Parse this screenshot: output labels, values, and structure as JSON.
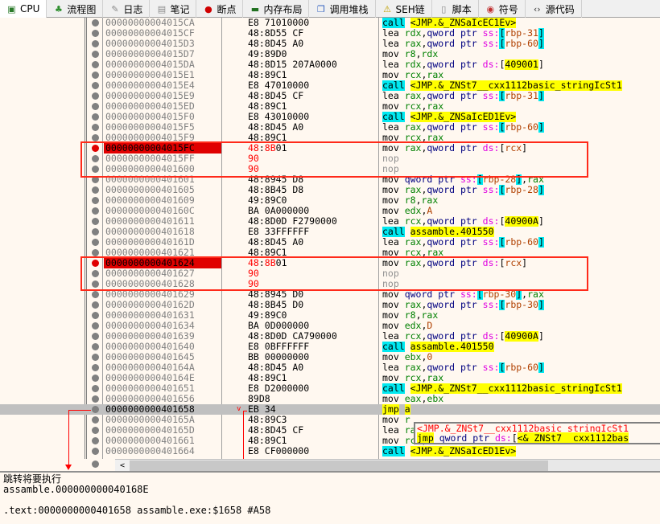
{
  "tabs": [
    {
      "label": "CPU",
      "icon": "cpu-icon",
      "active": true
    },
    {
      "label": "流程图",
      "icon": "tree-icon"
    },
    {
      "label": "日志",
      "icon": "log-icon"
    },
    {
      "label": "笔记",
      "icon": "notes-icon"
    },
    {
      "label": "断点",
      "icon": "breakpoint-icon"
    },
    {
      "label": "内存布局",
      "icon": "memory-icon"
    },
    {
      "label": "调用堆栈",
      "icon": "callstack-icon"
    },
    {
      "label": "SEH链",
      "icon": "seh-icon"
    },
    {
      "label": "脚本",
      "icon": "script-icon"
    },
    {
      "label": "符号",
      "icon": "symbol-icon"
    },
    {
      "label": "源代码",
      "icon": "source-icon"
    }
  ],
  "colors": {
    "breakpoint": "#e00000",
    "call_bg": "#00e8f0",
    "jmp_bg": "#ffff00",
    "highlight_box": "#ff2a1a"
  },
  "rows": [
    {
      "addr": "00000000004015CA",
      "bytes": [
        [
          "E8 71010000",
          ""
        ]
      ],
      "dis": [
        [
          "call",
          "call"
        ],
        [
          " ",
          ""
        ],
        [
          "<JMP.&_ZNSaIcEC1Ev>",
          "a"
        ]
      ]
    },
    {
      "addr": "00000000004015CF",
      "bytes": [
        [
          "48:8D55 CF",
          ""
        ]
      ],
      "dis": [
        [
          "lea ",
          "m"
        ],
        [
          "rdx",
          "r"
        ],
        [
          ",",
          ""
        ],
        [
          "qword ptr ",
          "s"
        ],
        [
          "ss:",
          "g"
        ],
        [
          "[",
          "bk"
        ],
        [
          "rbp-31",
          "n"
        ],
        [
          "]",
          "bk"
        ]
      ]
    },
    {
      "addr": "00000000004015D3",
      "bytes": [
        [
          "48:8D45 A0",
          ""
        ]
      ],
      "dis": [
        [
          "lea ",
          "m"
        ],
        [
          "rax",
          "r"
        ],
        [
          ",",
          ""
        ],
        [
          "qword ptr ",
          "s"
        ],
        [
          "ss:",
          "g"
        ],
        [
          "[",
          "bk"
        ],
        [
          "rbp-60",
          "n"
        ],
        [
          "]",
          "bk"
        ]
      ]
    },
    {
      "addr": "00000000004015D7",
      "bytes": [
        [
          "49:89D0",
          ""
        ]
      ],
      "dis": [
        [
          "mov ",
          "m"
        ],
        [
          "r8",
          "r"
        ],
        [
          ",",
          ""
        ],
        [
          "rdx",
          "r"
        ]
      ]
    },
    {
      "addr": "00000000004015DA",
      "bytes": [
        [
          "48:8D15 207A0000",
          ""
        ]
      ],
      "dis": [
        [
          "lea ",
          "m"
        ],
        [
          "rdx",
          "r"
        ],
        [
          ",",
          ""
        ],
        [
          "qword ptr ",
          "s"
        ],
        [
          "ds:",
          "g"
        ],
        [
          "[",
          ""
        ],
        [
          "409001",
          "a"
        ],
        [
          "]",
          ""
        ]
      ]
    },
    {
      "addr": "00000000004015E1",
      "bytes": [
        [
          "48:89C1",
          ""
        ]
      ],
      "dis": [
        [
          "mov ",
          "m"
        ],
        [
          "rcx",
          "r"
        ],
        [
          ",",
          ""
        ],
        [
          "rax",
          "r"
        ]
      ]
    },
    {
      "addr": "00000000004015E4",
      "bytes": [
        [
          "E8 47010000",
          ""
        ]
      ],
      "dis": [
        [
          "call",
          "call"
        ],
        [
          " ",
          ""
        ],
        [
          "<JMP.&_ZNSt7__cxx1112basic_stringIcSt1",
          "a"
        ]
      ]
    },
    {
      "addr": "00000000004015E9",
      "bytes": [
        [
          "48:8D45 CF",
          ""
        ]
      ],
      "dis": [
        [
          "lea ",
          "m"
        ],
        [
          "rax",
          "r"
        ],
        [
          ",",
          ""
        ],
        [
          "qword ptr ",
          "s"
        ],
        [
          "ss:",
          "g"
        ],
        [
          "[",
          "bk"
        ],
        [
          "rbp-31",
          "n"
        ],
        [
          "]",
          "bk"
        ]
      ]
    },
    {
      "addr": "00000000004015ED",
      "bytes": [
        [
          "48:89C1",
          ""
        ]
      ],
      "dis": [
        [
          "mov ",
          "m"
        ],
        [
          "rcx",
          "r"
        ],
        [
          ",",
          ""
        ],
        [
          "rax",
          "r"
        ]
      ]
    },
    {
      "addr": "00000000004015F0",
      "bytes": [
        [
          "E8 43010000",
          ""
        ]
      ],
      "dis": [
        [
          "call",
          "call"
        ],
        [
          " ",
          ""
        ],
        [
          "<JMP.&_ZNSaIcED1Ev>",
          "a"
        ]
      ]
    },
    {
      "addr": "00000000004015F5",
      "bytes": [
        [
          "48:8D45 A0",
          ""
        ]
      ],
      "dis": [
        [
          "lea ",
          "m"
        ],
        [
          "rax",
          "r"
        ],
        [
          ",",
          ""
        ],
        [
          "qword ptr ",
          "s"
        ],
        [
          "ss:",
          "g"
        ],
        [
          "[",
          "bk"
        ],
        [
          "rbp-60",
          "n"
        ],
        [
          "]",
          "bk"
        ]
      ]
    },
    {
      "addr": "00000000004015F9",
      "bytes": [
        [
          "48:89C1",
          ""
        ]
      ],
      "dis": [
        [
          "mov ",
          "m"
        ],
        [
          "rcx",
          "r"
        ],
        [
          ",",
          ""
        ],
        [
          "rax",
          "r"
        ]
      ]
    },
    {
      "addr": "00000000004015FC",
      "bp": true,
      "bytes": [
        [
          "48",
          "red"
        ],
        [
          ":",
          ""
        ],
        [
          "8B",
          "red"
        ],
        [
          "01",
          ""
        ]
      ],
      "dis": [
        [
          "mov ",
          "m"
        ],
        [
          "rax",
          "r"
        ],
        [
          ",",
          ""
        ],
        [
          "qword ptr ",
          "s"
        ],
        [
          "ds:",
          "g"
        ],
        [
          "[",
          ""
        ],
        [
          "rcx",
          "n"
        ],
        [
          "]",
          ""
        ]
      ]
    },
    {
      "addr": "00000000004015FF",
      "bytes": [
        [
          "90",
          "red"
        ]
      ],
      "dis": [
        [
          "nop",
          "nop"
        ]
      ]
    },
    {
      "addr": "0000000000401600",
      "bytes": [
        [
          "90",
          "red"
        ]
      ],
      "dis": [
        [
          "nop",
          "nop"
        ]
      ]
    },
    {
      "addr": "0000000000401601",
      "bytes": [
        [
          "48:8945 D8",
          ""
        ]
      ],
      "dis": [
        [
          "mov ",
          "m"
        ],
        [
          "qword ptr ",
          "s"
        ],
        [
          "ss:",
          "g"
        ],
        [
          "[",
          "bk"
        ],
        [
          "rbp-28",
          "n"
        ],
        [
          "]",
          "bk"
        ],
        [
          ",",
          ""
        ],
        [
          "rax",
          "r"
        ]
      ]
    },
    {
      "addr": "0000000000401605",
      "bytes": [
        [
          "48:8B45 D8",
          ""
        ]
      ],
      "dis": [
        [
          "mov ",
          "m"
        ],
        [
          "rax",
          "r"
        ],
        [
          ",",
          ""
        ],
        [
          "qword ptr ",
          "s"
        ],
        [
          "ss:",
          "g"
        ],
        [
          "[",
          "bk"
        ],
        [
          "rbp-28",
          "n"
        ],
        [
          "]",
          "bk"
        ]
      ]
    },
    {
      "addr": "0000000000401609",
      "bytes": [
        [
          "49:89C0",
          ""
        ]
      ],
      "dis": [
        [
          "mov ",
          "m"
        ],
        [
          "r8",
          "r"
        ],
        [
          ",",
          ""
        ],
        [
          "rax",
          "r"
        ]
      ]
    },
    {
      "addr": "000000000040160C",
      "bytes": [
        [
          "BA 0A000000",
          ""
        ]
      ],
      "dis": [
        [
          "mov ",
          "m"
        ],
        [
          "edx",
          "r"
        ],
        [
          ",",
          ""
        ],
        [
          "A",
          "n"
        ]
      ]
    },
    {
      "addr": "0000000000401611",
      "bytes": [
        [
          "48:8D0D F2790000",
          ""
        ]
      ],
      "dis": [
        [
          "lea ",
          "m"
        ],
        [
          "rcx",
          "r"
        ],
        [
          ",",
          ""
        ],
        [
          "qword ptr ",
          "s"
        ],
        [
          "ds:",
          "g"
        ],
        [
          "[",
          ""
        ],
        [
          "40900A",
          "a"
        ],
        [
          "]",
          ""
        ]
      ]
    },
    {
      "addr": "0000000000401618",
      "bytes": [
        [
          "E8 33FFFFFF",
          ""
        ]
      ],
      "dis": [
        [
          "call",
          "call"
        ],
        [
          " ",
          ""
        ],
        [
          "assamble.401550",
          "a"
        ]
      ]
    },
    {
      "addr": "000000000040161D",
      "bytes": [
        [
          "48:8D45 A0",
          ""
        ]
      ],
      "dis": [
        [
          "lea ",
          "m"
        ],
        [
          "rax",
          "r"
        ],
        [
          ",",
          ""
        ],
        [
          "qword ptr ",
          "s"
        ],
        [
          "ss:",
          "g"
        ],
        [
          "[",
          "bk"
        ],
        [
          "rbp-60",
          "n"
        ],
        [
          "]",
          "bk"
        ]
      ]
    },
    {
      "addr": "0000000000401621",
      "bytes": [
        [
          "48:89C1",
          ""
        ]
      ],
      "dis": [
        [
          "mov ",
          "m"
        ],
        [
          "rcx",
          "r"
        ],
        [
          ",",
          ""
        ],
        [
          "rax",
          "r"
        ]
      ]
    },
    {
      "addr": "0000000000401624",
      "bp": true,
      "bytes": [
        [
          "48",
          "red"
        ],
        [
          ":",
          ""
        ],
        [
          "8B",
          "red"
        ],
        [
          "01",
          ""
        ]
      ],
      "dis": [
        [
          "mov ",
          "m"
        ],
        [
          "rax",
          "r"
        ],
        [
          ",",
          ""
        ],
        [
          "qword ptr ",
          "s"
        ],
        [
          "ds:",
          "g"
        ],
        [
          "[",
          ""
        ],
        [
          "rcx",
          "n"
        ],
        [
          "]",
          ""
        ]
      ]
    },
    {
      "addr": "0000000000401627",
      "bytes": [
        [
          "90",
          "red"
        ]
      ],
      "dis": [
        [
          "nop",
          "nop"
        ]
      ]
    },
    {
      "addr": "0000000000401628",
      "bytes": [
        [
          "90",
          "red"
        ]
      ],
      "dis": [
        [
          "nop",
          "nop"
        ]
      ]
    },
    {
      "addr": "0000000000401629",
      "bytes": [
        [
          "48:8945 D0",
          ""
        ]
      ],
      "dis": [
        [
          "mov ",
          "m"
        ],
        [
          "qword ptr ",
          "s"
        ],
        [
          "ss:",
          "g"
        ],
        [
          "[",
          "bk"
        ],
        [
          "rbp-30",
          "n"
        ],
        [
          "]",
          "bk"
        ],
        [
          ",",
          ""
        ],
        [
          "rax",
          "r"
        ]
      ]
    },
    {
      "addr": "000000000040162D",
      "bytes": [
        [
          "48:8B45 D0",
          ""
        ]
      ],
      "dis": [
        [
          "mov ",
          "m"
        ],
        [
          "rax",
          "r"
        ],
        [
          ",",
          ""
        ],
        [
          "qword ptr ",
          "s"
        ],
        [
          "ss:",
          "g"
        ],
        [
          "[",
          "bk"
        ],
        [
          "rbp-30",
          "n"
        ],
        [
          "]",
          "bk"
        ]
      ]
    },
    {
      "addr": "0000000000401631",
      "bytes": [
        [
          "49:89C0",
          ""
        ]
      ],
      "dis": [
        [
          "mov ",
          "m"
        ],
        [
          "r8",
          "r"
        ],
        [
          ",",
          ""
        ],
        [
          "rax",
          "r"
        ]
      ]
    },
    {
      "addr": "0000000000401634",
      "bytes": [
        [
          "BA 0D000000",
          ""
        ]
      ],
      "dis": [
        [
          "mov ",
          "m"
        ],
        [
          "edx",
          "r"
        ],
        [
          ",",
          ""
        ],
        [
          "D",
          "n"
        ]
      ]
    },
    {
      "addr": "0000000000401639",
      "bytes": [
        [
          "48:8D0D CA790000",
          ""
        ]
      ],
      "dis": [
        [
          "lea ",
          "m"
        ],
        [
          "rcx",
          "r"
        ],
        [
          ",",
          ""
        ],
        [
          "qword ptr ",
          "s"
        ],
        [
          "ds:",
          "g"
        ],
        [
          "[",
          ""
        ],
        [
          "40900A",
          "a"
        ],
        [
          "]",
          ""
        ]
      ]
    },
    {
      "addr": "0000000000401640",
      "bytes": [
        [
          "E8 0BFFFFFF",
          ""
        ]
      ],
      "dis": [
        [
          "call",
          "call"
        ],
        [
          " ",
          ""
        ],
        [
          "assamble.401550",
          "a"
        ]
      ]
    },
    {
      "addr": "0000000000401645",
      "bytes": [
        [
          "BB 00000000",
          ""
        ]
      ],
      "dis": [
        [
          "mov ",
          "m"
        ],
        [
          "ebx",
          "r"
        ],
        [
          ",",
          ""
        ],
        [
          "0",
          "n"
        ]
      ]
    },
    {
      "addr": "000000000040164A",
      "bytes": [
        [
          "48:8D45 A0",
          ""
        ]
      ],
      "dis": [
        [
          "lea ",
          "m"
        ],
        [
          "rax",
          "r"
        ],
        [
          ",",
          ""
        ],
        [
          "qword ptr ",
          "s"
        ],
        [
          "ss:",
          "g"
        ],
        [
          "[",
          "bk"
        ],
        [
          "rbp-60",
          "n"
        ],
        [
          "]",
          "bk"
        ]
      ]
    },
    {
      "addr": "000000000040164E",
      "bytes": [
        [
          "48:89C1",
          ""
        ]
      ],
      "dis": [
        [
          "mov ",
          "m"
        ],
        [
          "rcx",
          "r"
        ],
        [
          ",",
          ""
        ],
        [
          "rax",
          "r"
        ]
      ]
    },
    {
      "addr": "0000000000401651",
      "bytes": [
        [
          "E8 D2000000",
          ""
        ]
      ],
      "dis": [
        [
          "call",
          "call"
        ],
        [
          " ",
          ""
        ],
        [
          "<JMP.&_ZNSt7__cxx1112basic_stringIcSt1",
          "a"
        ]
      ]
    },
    {
      "addr": "0000000000401656",
      "bytes": [
        [
          "89D8",
          ""
        ]
      ],
      "dis": [
        [
          "mov ",
          "m"
        ],
        [
          "eax",
          "r"
        ],
        [
          ",",
          ""
        ],
        [
          "ebx",
          "r"
        ]
      ]
    },
    {
      "addr": "0000000000401658",
      "sel": true,
      "bytes": [
        [
          "EB 34",
          ""
        ]
      ],
      "dis": [
        [
          "jmp",
          "jmp"
        ],
        [
          " ",
          ""
        ],
        [
          "a",
          "a"
        ]
      ]
    },
    {
      "addr": "000000000040165A",
      "bytes": [
        [
          "48:89C3",
          ""
        ]
      ],
      "dis": [
        [
          "mov ",
          "m"
        ],
        [
          "r",
          "r"
        ]
      ]
    },
    {
      "addr": "000000000040165D",
      "bytes": [
        [
          "48:8D45 CF",
          ""
        ]
      ],
      "dis": [
        [
          "lea ",
          "m"
        ],
        [
          "rax",
          "r"
        ],
        [
          ",",
          ""
        ],
        [
          "qword ptr ",
          "s"
        ],
        [
          "ss:",
          "g"
        ],
        [
          "[",
          "bk"
        ],
        [
          "rbp-31",
          "n"
        ],
        [
          "]",
          "bk"
        ]
      ]
    },
    {
      "addr": "0000000000401661",
      "bytes": [
        [
          "48:89C1",
          ""
        ]
      ],
      "dis": [
        [
          "mov ",
          "m"
        ],
        [
          "rcx",
          "r"
        ],
        [
          ",",
          ""
        ],
        [
          "rax",
          "r"
        ]
      ]
    },
    {
      "addr": "0000000000401664",
      "bytes": [
        [
          "E8 CF000000",
          ""
        ]
      ],
      "dis": [
        [
          "call",
          "call"
        ],
        [
          " ",
          ""
        ],
        [
          "<JMP.&_ZNSaIcED1Ev>",
          "a"
        ]
      ]
    }
  ],
  "tooltip": {
    "line1": "<JMP.&_ZNSt7__cxx1112basic_stringIcSt1",
    "line2": [
      [
        "jmp",
        "jmp"
      ],
      [
        " qword ptr ",
        "s"
      ],
      [
        "ds:",
        "g"
      ],
      [
        "[",
        ""
      ],
      [
        "<&_ZNSt7__cxx1112bas",
        "a"
      ]
    ]
  },
  "info": {
    "line1": "跳转将要执行",
    "line2": "assamble.000000000040168E",
    "line3": "",
    "line4": ".text:0000000000401658 assamble.exe:$1658 #A58"
  },
  "scroll_left": "<"
}
